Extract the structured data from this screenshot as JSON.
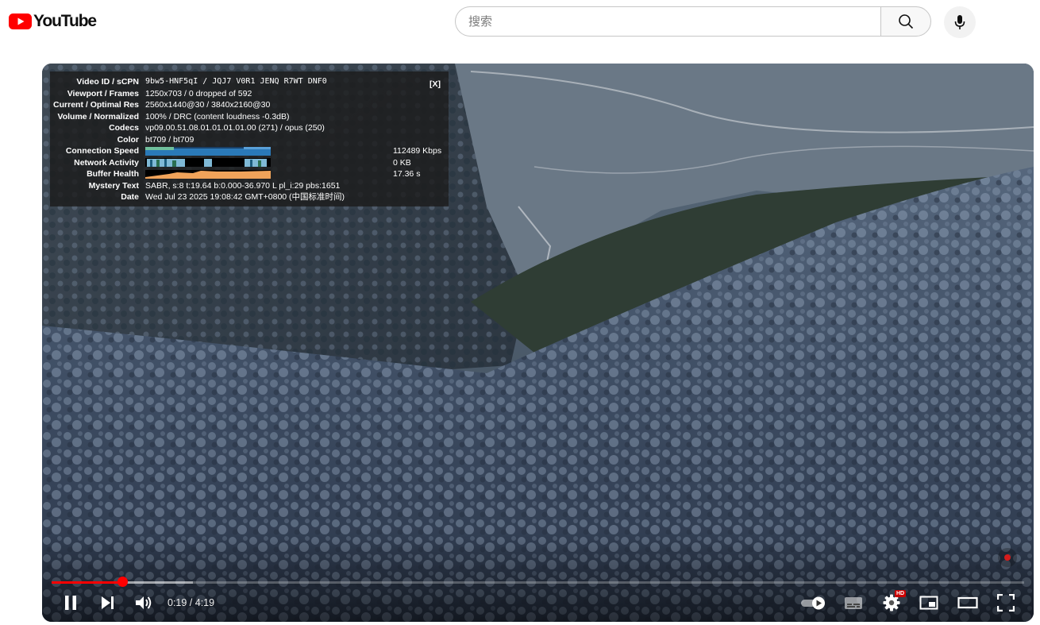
{
  "masthead": {
    "logo_text": "YouTube",
    "search_placeholder": "搜索",
    "search_icon": "search-icon",
    "mic_icon": "microphone-icon"
  },
  "stats": {
    "close_label": "[X]",
    "rows": {
      "video_id": {
        "label": "Video ID / sCPN",
        "value": "9bw5-HNF5qI / JQJ7 V0R1 JENQ R7WT DNF0"
      },
      "viewport": {
        "label": "Viewport / Frames",
        "value": "1250x703 / 0 dropped of 592"
      },
      "resolution": {
        "label": "Current / Optimal Res",
        "value": "2560x1440@30 / 3840x2160@30"
      },
      "volume": {
        "label": "Volume / Normalized",
        "value": "100% / DRC (content loudness -0.3dB)"
      },
      "codecs": {
        "label": "Codecs",
        "value": "vp09.00.51.08.01.01.01.01.00 (271) / opus (250)"
      },
      "color": {
        "label": "Color",
        "value": "bt709 / bt709"
      },
      "connection": {
        "label": "Connection Speed",
        "value": "112489 Kbps"
      },
      "network": {
        "label": "Network Activity",
        "value": "0 KB"
      },
      "buffer": {
        "label": "Buffer Health",
        "value": "17.36 s"
      },
      "mystery": {
        "label": "Mystery Text",
        "value": "SABR, s:8 t:19.64 b:0.000-36.970 L pl_i:29 pbs:1651"
      },
      "date": {
        "label": "Date",
        "value": "Wed Jul 23 2025 19:08:42 GMT+0800 (中国标准时间)"
      }
    }
  },
  "player": {
    "time_display": "0:19 / 4:19",
    "progress_played_fraction": 0.073,
    "progress_loaded_fraction": 0.145,
    "hd_badge": "HD",
    "colors": {
      "accent": "#ff0000",
      "overlay": "#1c1c1c"
    },
    "icons": [
      "pause-icon",
      "next-icon",
      "volume-icon",
      "autoplay-toggle-icon",
      "subtitles-icon",
      "settings-icon",
      "miniplayer-icon",
      "theater-mode-icon",
      "fullscreen-icon"
    ]
  }
}
